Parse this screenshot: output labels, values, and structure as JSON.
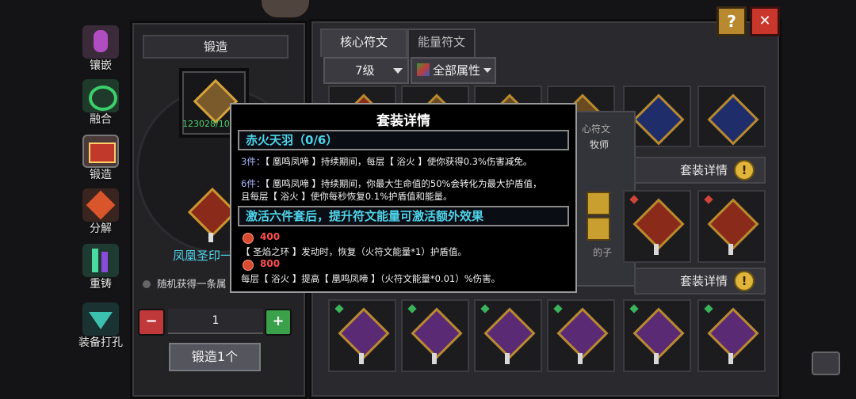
{
  "nav": {
    "items": [
      {
        "label": "镶嵌",
        "color": "#8c3d8c"
      },
      {
        "label": "融合",
        "color": "#2f9a5a"
      },
      {
        "label": "锻造",
        "color": "#c0392b"
      },
      {
        "label": "分解",
        "color": "#c0452b"
      },
      {
        "label": "重铸",
        "color": "#3c8a6a"
      },
      {
        "label": "装备打孔",
        "color": "#2a7a7a"
      }
    ]
  },
  "forge": {
    "title": "锻造",
    "count": "123028/10",
    "rune_name": "凤凰圣印",
    "rune_name_suffix": "一",
    "random_note": "随机获得一条属",
    "quantity": "1",
    "forge_button": "锻造1个",
    "minus": "−",
    "plus": "+"
  },
  "window": {
    "help": "?",
    "close": "✕"
  },
  "tabs": [
    {
      "label": "核心符文"
    },
    {
      "label": "能量符文"
    }
  ],
  "filters": {
    "level": "7级",
    "attribute": "全部属性"
  },
  "partial_texts": {
    "core_rune": "心符文",
    "class": "牧师",
    "desc_tail": "的子"
  },
  "set_detail_label": "套装详情",
  "set_detail_mark": "!",
  "popup": {
    "title": "套装详情",
    "set_name": "赤火天羽（0/6）",
    "bonus3_label": "3件：",
    "bonus3": "【 凰鸣凤啼 】持续期间，每层【 浴火 】使你获得0.3%伤害减免。",
    "bonus6_label": "6件：",
    "bonus6_line1": "【 凰鸣凤啼 】持续期间，你最大生命值的50%会转化为最大护盾值，",
    "bonus6_line2": "且每层【 浴火 】使你每秒恢复0.1%护盾值和能量。",
    "activate_title": "激活六件套后，提升符文能量可激活额外效果",
    "tier1_energy": "400",
    "tier1_text": "【 圣焰之环 】发动时，恢复（火符文能量*1）护盾值。",
    "tier2_energy": "800",
    "tier2_text": "每层【 浴火 】提高【 凰鸣凤啼 】（火符文能量*0.01）%伤害。"
  }
}
